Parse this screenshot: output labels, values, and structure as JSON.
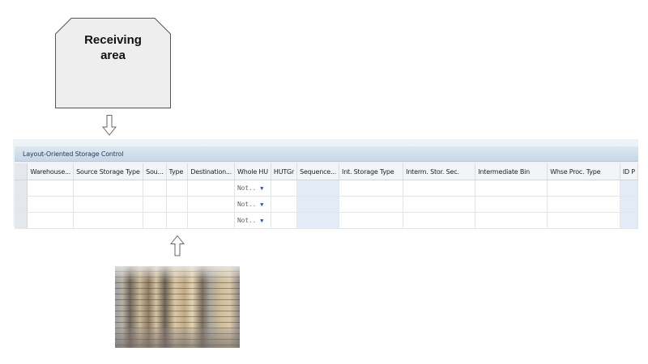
{
  "receiving_area": {
    "label": "Receiving\narea",
    "fill": "#eeeeee",
    "stroke": "#555555"
  },
  "panel": {
    "title": "Layout-Oriented Storage Control",
    "columns": [
      "Warehouse...",
      "Source Storage Type",
      "Sou...",
      "Type",
      "Destination...",
      "Whole HU",
      "HUTGr",
      "Sequence...",
      "Int. Storage Type",
      "Interm. Stor. Sec.",
      "Intermediate Bin",
      "Whse Proc. Type",
      "ID P"
    ],
    "rows": [
      {
        "whole_hu": "Not.."
      },
      {
        "whole_hu": "Not.."
      },
      {
        "whole_hu": "Not.."
      }
    ]
  },
  "icons": {
    "down_arrow": "arrow-down-outline",
    "up_arrow": "arrow-up-outline",
    "dropdown": "caret-down"
  },
  "colors": {
    "title_bar": "#c6d7e6",
    "highlight_column": "#e3ecf6"
  }
}
